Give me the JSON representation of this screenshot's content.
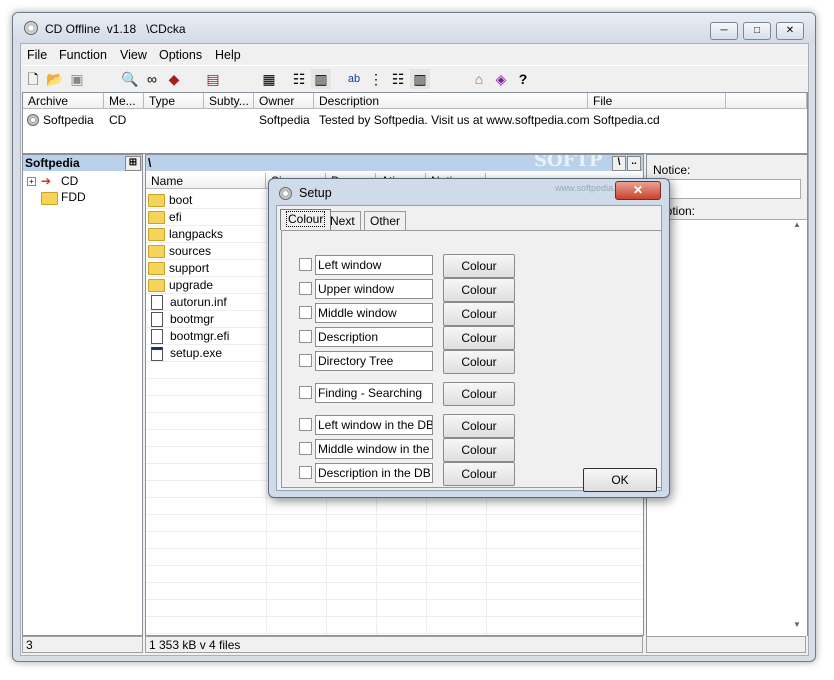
{
  "window": {
    "title": "CD Offline  v1.18   \\CDcka",
    "controls": {
      "minimize": "─",
      "maximize": "□",
      "close": "✕"
    }
  },
  "menu": [
    "File",
    "Function",
    "View",
    "Options",
    "Help"
  ],
  "toolbar_icons": [
    "new-icon",
    "open-folder-icon",
    "save-icon",
    "search-icon",
    "binoculars-icon",
    "paint-icon",
    "print-icon",
    "grid-icon",
    "list-view-icon",
    "details-view-icon",
    "sort-name-icon",
    "tree-icon",
    "tree-list-icon",
    "columns-icon",
    "home-icon",
    "book-icon",
    "help-icon"
  ],
  "archive_table": {
    "headers": [
      "Archive",
      "Me...",
      "Type",
      "Subty...",
      "Owner",
      "Description",
      "File"
    ],
    "rows": [
      [
        "Softpedia",
        "CD",
        "",
        "",
        "Softpedia",
        "Tested by Softpedia. Visit us at www.softpedia.com",
        "Softpedia.cd"
      ]
    ]
  },
  "left_pane": {
    "title": "Softpedia",
    "tree": [
      {
        "label": "CD",
        "expander": "+"
      },
      {
        "label": "FDD",
        "expander": ""
      }
    ]
  },
  "middle_pane": {
    "path": "\\",
    "columns": [
      "Name",
      "Si",
      "Da",
      "Ati",
      "Notic"
    ],
    "path_buttons": [
      "\\",
      ".."
    ],
    "files": [
      {
        "name": "boot",
        "kind": "folder"
      },
      {
        "name": "efi",
        "kind": "folder"
      },
      {
        "name": "langpacks",
        "kind": "folder"
      },
      {
        "name": "sources",
        "kind": "folder"
      },
      {
        "name": "support",
        "kind": "folder"
      },
      {
        "name": "upgrade",
        "kind": "folder"
      },
      {
        "name": "autorun.inf",
        "kind": "file"
      },
      {
        "name": "bootmgr",
        "kind": "file"
      },
      {
        "name": "bootmgr.efi",
        "kind": "file"
      },
      {
        "name": "setup.exe",
        "kind": "file"
      }
    ]
  },
  "right_pane": {
    "notice_label": "Notice:",
    "description_label": "scription:"
  },
  "status": {
    "left": "3",
    "middle": "1 353 kB v 4 files"
  },
  "watermark": "SOFTP",
  "watermark_url": "www.softpedia.com",
  "dialog": {
    "title": "Setup",
    "close": "✕",
    "tabs": [
      "Colour",
      "Next",
      "Other"
    ],
    "active_tab": "Colour",
    "items": [
      {
        "label": "Left window",
        "button": "Colour"
      },
      {
        "label": "Upper window",
        "button": "Colour"
      },
      {
        "label": "Middle window",
        "button": "Colour"
      },
      {
        "label": "Description",
        "button": "Colour"
      },
      {
        "label": "Directory Tree",
        "button": "Colour"
      },
      {
        "label": "Finding - Searching",
        "button": "Colour"
      },
      {
        "label": "Left window in the DB",
        "button": "Colour"
      },
      {
        "label": "Middle window in the DB",
        "button": "Colour"
      },
      {
        "label": "Description in the DB",
        "button": "Colour"
      }
    ],
    "ok": "OK"
  },
  "colors": {
    "pane_header": "#b9d1ea",
    "dialog_frame": "#cfdbe9",
    "close_red": "#c8432f"
  }
}
